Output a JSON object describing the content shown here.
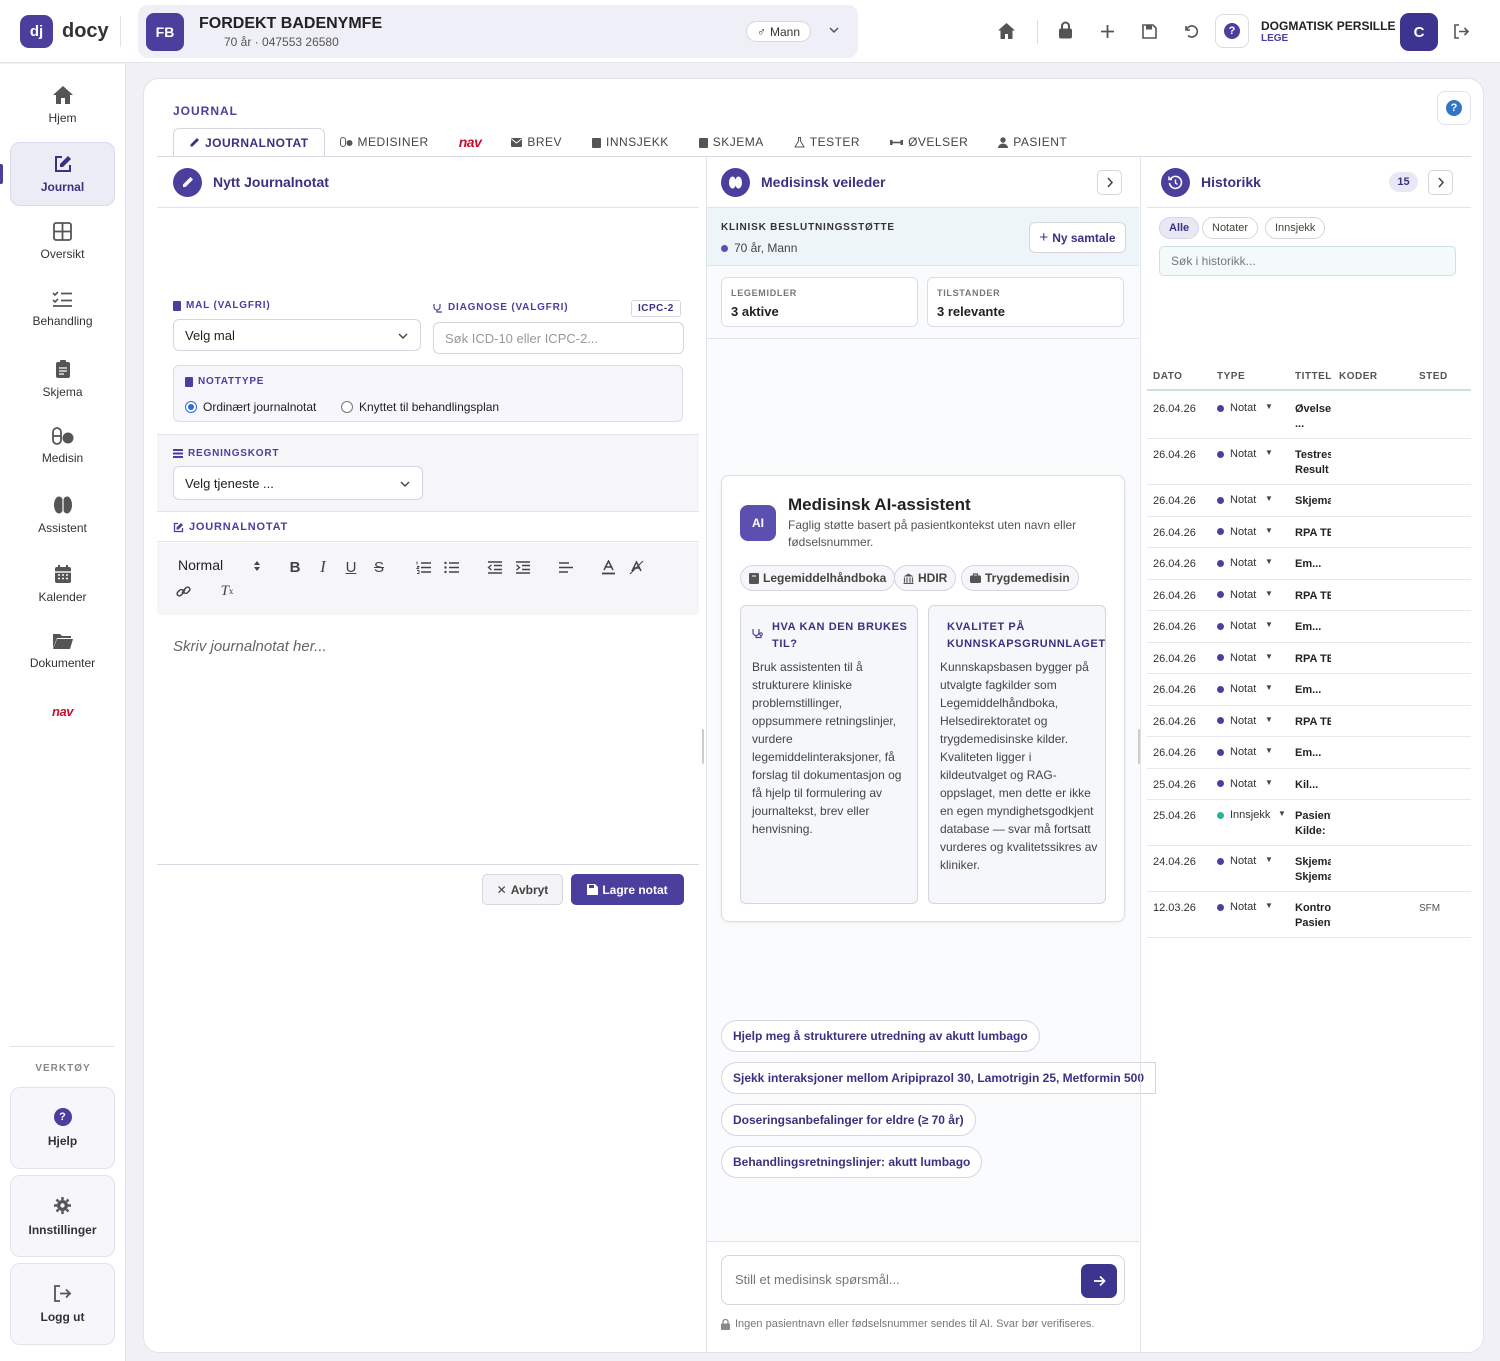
{
  "app": {
    "logo_mark": "dj",
    "logo_text": "docy"
  },
  "patient": {
    "initials": "FB",
    "name": "FORDEKT BADENYMFE",
    "info": "70 år · 047553 26580",
    "gender": "Mann"
  },
  "user": {
    "name": "DOGMATISK PERSILLE",
    "role": "LEGE",
    "initial": "C"
  },
  "sidebar": {
    "items": [
      {
        "label": "Hjem"
      },
      {
        "label": "Journal"
      },
      {
        "label": "Oversikt"
      },
      {
        "label": "Behandling"
      },
      {
        "label": "Skjema"
      },
      {
        "label": "Medisin"
      },
      {
        "label": "Assistent"
      },
      {
        "label": "Kalender"
      },
      {
        "label": "Dokumenter"
      },
      {
        "label": "nav"
      }
    ],
    "tools_title": "VERKTØY",
    "help": "Hjelp",
    "settings": "Innstillinger",
    "logout": "Logg ut"
  },
  "journal": {
    "title": "JOURNAL",
    "tabs": [
      "JOURNALNOTAT",
      "MEDISINER",
      "nav",
      "BREV",
      "INNSJEKK",
      "SKJEMA",
      "TESTER",
      "ØVELSER",
      "PASIENT"
    ]
  },
  "note": {
    "header": "Nytt Journalnotat",
    "mal_label": "MAL (VALGFRI)",
    "mal_value": "Velg mal",
    "diag_label": "DIAGNOSE (VALGFRI)",
    "icpc": "ICPC-2",
    "diag_placeholder": "Søk ICD-10 eller ICPC-2...",
    "notattype_label": "NOTATTYPE",
    "radio1": "Ordinært journalnotat",
    "radio2": "Knyttet til behandlingsplan",
    "regning_label": "REGNINGSKORT",
    "regning_value": "Velg tjeneste ...",
    "journalnotat_label": "JOURNALNOTAT",
    "format_value": "Normal",
    "editor_placeholder": "Skriv journalnotat her...",
    "cancel": "Avbryt",
    "save": "Lagre notat"
  },
  "advisor": {
    "header": "Medisinsk veileder",
    "cds_title": "KLINISK BESLUTNINGSSTØTTE",
    "cds_sub": "70 år, Mann",
    "new_chat": "Ny samtale",
    "stats": [
      {
        "label": "LEGEMIDLER",
        "value": "3 aktive"
      },
      {
        "label": "TILSTANDER",
        "value": "3 relevante"
      }
    ],
    "ai_badge": "AI",
    "ai_title": "Medisinsk AI-assistent",
    "ai_sub": "Faglig støtte basert på pasientkontekst uten navn eller fødselsnummer.",
    "chips": [
      "Legemiddelhåndboka",
      "HDIR",
      "Trygdemedisin"
    ],
    "info1_title": "HVA KAN DEN BRUKES TIL?",
    "info1_body": "Bruk assistenten til å strukturere kliniske problemstillinger, oppsummere retningslinjer, vurdere legemiddelinteraksjoner, få forslag til dokumentasjon og få hjelp til formulering av journaltekst, brev eller henvisning.",
    "info2_title": "KVALITET PÅ KUNNSKAPSGRUNNLAGET",
    "info2_body": "Kunnskapsbasen bygger på utvalgte fagkilder som Legemiddelhåndboka, Helsedirektoratet og trygdemedisinske kilder. Kvaliteten ligger i kildeutvalget og RAG-oppslaget, men dette er ikke en egen myndighetsgodkjent database — svar må fortsatt vurderes og kvalitetssikres av kliniker.",
    "suggestions": [
      "Hjelp meg å strukturere utredning av akutt lumbago",
      "Sjekk interaksjoner mellom Aripiprazol 30, Lamotrigin 25, Metformin 500",
      "Doseringsanbefalinger for eldre (≥ 70 år)",
      "Behandlingsretningslinjer: akutt lumbago"
    ],
    "chat_placeholder": "Still et medisinsk spørsmål...",
    "disclaimer": "Ingen pasientnavn eller fødselsnummer sendes til AI. Svar bør verifiseres."
  },
  "history": {
    "header": "Historikk",
    "count": "15",
    "filters": [
      "Alle",
      "Notater",
      "Innsjekk"
    ],
    "search_placeholder": "Søk i historikk...",
    "columns": [
      "DATO",
      "TYPE",
      "TITTEL",
      "KODER",
      "STED"
    ],
    "rows": [
      {
        "date": "26.04.26",
        "type": "Notat",
        "title1": "Øvelse",
        "title2": "...",
        "place": "",
        "color": "#4b3f9e"
      },
      {
        "date": "26.04.26",
        "type": "Notat",
        "title1": "Testresultat",
        "title2": "Result",
        "place": "",
        "color": "#4b3f9e"
      },
      {
        "date": "26.04.26",
        "type": "Notat",
        "title1": "Skjema",
        "title2": "",
        "place": "",
        "color": "#4b3f9e"
      },
      {
        "date": "26.04.26",
        "type": "Notat",
        "title1": "RPA TEST",
        "title2": "",
        "place": "",
        "color": "#4b3f9e"
      },
      {
        "date": "26.04.26",
        "type": "Notat",
        "title1": "Em...",
        "title2": "",
        "place": "",
        "color": "#4b3f9e"
      },
      {
        "date": "26.04.26",
        "type": "Notat",
        "title1": "RPA TEST",
        "title2": "",
        "place": "",
        "color": "#4b3f9e"
      },
      {
        "date": "26.04.26",
        "type": "Notat",
        "title1": "Em...",
        "title2": "",
        "place": "",
        "color": "#4b3f9e"
      },
      {
        "date": "26.04.26",
        "type": "Notat",
        "title1": "RPA TEST",
        "title2": "",
        "place": "",
        "color": "#4b3f9e"
      },
      {
        "date": "26.04.26",
        "type": "Notat",
        "title1": "Em...",
        "title2": "",
        "place": "",
        "color": "#4b3f9e"
      },
      {
        "date": "26.04.26",
        "type": "Notat",
        "title1": "RPA TEST",
        "title2": "",
        "place": "",
        "color": "#4b3f9e"
      },
      {
        "date": "26.04.26",
        "type": "Notat",
        "title1": "Em...",
        "title2": "",
        "place": "",
        "color": "#4b3f9e"
      },
      {
        "date": "25.04.26",
        "type": "Notat",
        "title1": "Kil...",
        "title2": "",
        "place": "",
        "color": "#4b3f9e"
      },
      {
        "date": "25.04.26",
        "type": "Innsjekk",
        "title1": "Pasient",
        "title2": "Kilde:",
        "place": "",
        "color": "#22b59a"
      },
      {
        "date": "24.04.26",
        "type": "Notat",
        "title1": "Skjema",
        "title2": "Skjema",
        "place": "",
        "color": "#4b3f9e"
      },
      {
        "date": "12.03.26",
        "type": "Notat",
        "title1": "Kontroll",
        "title2": "Pasient",
        "place": "SFM",
        "color": "#4b3f9e"
      }
    ]
  },
  "colors": {
    "primary": "#4b3f9e",
    "nav_red": "#c8102e",
    "innsjekk": "#22b59a"
  }
}
